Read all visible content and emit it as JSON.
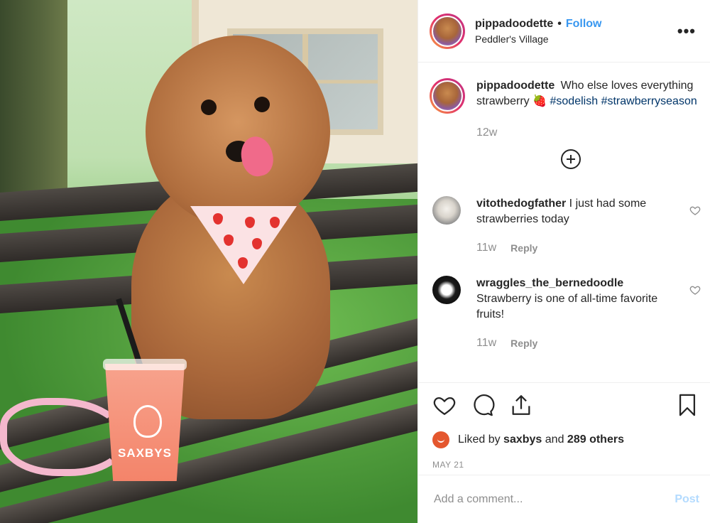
{
  "post": {
    "username": "pippadoodette",
    "follow_label": "Follow",
    "separator": "•",
    "location": "Peddler's Village",
    "more_label": "•••",
    "photo_cup_brand": "SAXBYS"
  },
  "caption": {
    "username": "pippadoodette",
    "text": "Who else loves everything strawberry 🍓",
    "hashtag1": "#sodelish",
    "hashtag2": "#strawberryseason",
    "time": "12w"
  },
  "comments": [
    {
      "username": "vitothedogfather",
      "text": "I just had some strawberries today",
      "time": "11w",
      "reply_label": "Reply"
    },
    {
      "username": "wraggles_the_bernedoodle",
      "text": "Strawberry is one of all-time favorite fruits!",
      "time": "11w",
      "reply_label": "Reply"
    }
  ],
  "likes": {
    "prefix": "Liked by",
    "user": "saxbys",
    "joiner": "and",
    "count": "289 others"
  },
  "date": "MAY 21",
  "add_comment": {
    "placeholder": "Add a comment...",
    "post_label": "Post"
  },
  "colors": {
    "link_blue": "#3897f0",
    "hashtag": "#003569",
    "muted": "#8e8e8e",
    "post_disabled": "#b3dbff"
  },
  "icons": [
    "heart-icon",
    "comment-icon",
    "share-icon",
    "bookmark-icon",
    "plus-circle-icon",
    "more-icon"
  ]
}
